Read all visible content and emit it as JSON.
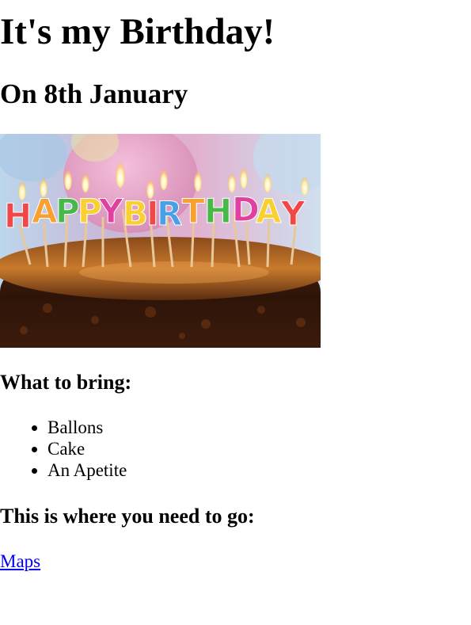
{
  "page": {
    "title": "It's my Birthday!",
    "subtitle": "On 8th January"
  },
  "image": {
    "icon": "birthday-cake-image",
    "cake_text": "HAPPY BIRTHDAY"
  },
  "bring": {
    "heading": "What to bring:",
    "items": [
      {
        "label": "Ballons"
      },
      {
        "label": "Cake"
      },
      {
        "label": "An Apetite"
      }
    ]
  },
  "location": {
    "heading": "This is where you need to go:",
    "link_label": "Maps"
  },
  "colors": {
    "link": "#0000ee",
    "text": "#000000",
    "background": "#ffffff"
  }
}
